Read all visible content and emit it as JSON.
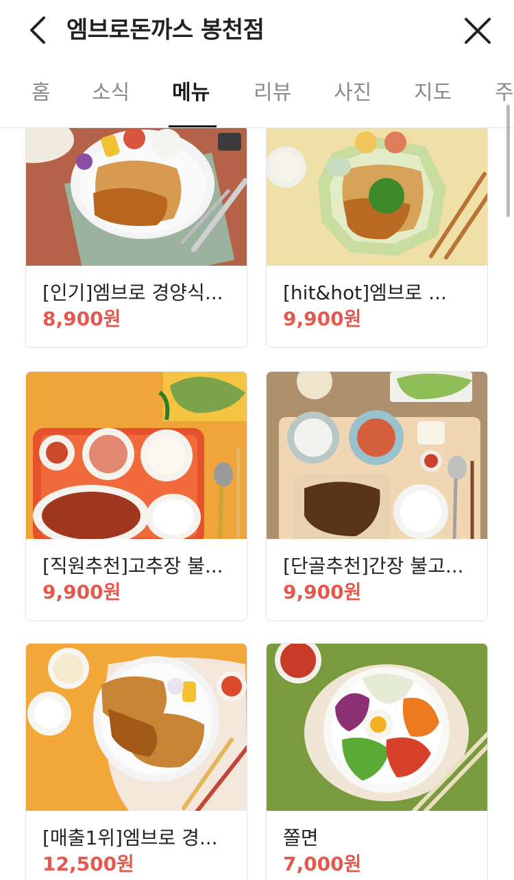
{
  "header": {
    "title": "엠브로돈까스 봉천점",
    "back_icon": "chevron-left-icon",
    "close_icon": "close-icon"
  },
  "tabs": [
    {
      "label": "홈",
      "active": false
    },
    {
      "label": "소식",
      "active": false
    },
    {
      "label": "메뉴",
      "active": true
    },
    {
      "label": "리뷰",
      "active": false
    },
    {
      "label": "사진",
      "active": false
    },
    {
      "label": "지도",
      "active": false
    },
    {
      "label": "주",
      "active": false
    }
  ],
  "colors": {
    "price": "#e25a4f",
    "active_tab": "#1a1a1a",
    "inactive_tab": "#8a8a8a"
  },
  "menu": [
    {
      "name": "[인기]엠브로 경양식...",
      "price": "8,900원",
      "image": "pork-cutlet-salad-photo"
    },
    {
      "name": "[hit&hot]엠브로 ...",
      "price": "9,900원",
      "image": "pork-cutlet-green-onion-photo"
    },
    {
      "name": "[직원추천]고추장 불...",
      "price": "9,900원",
      "image": "spicy-pork-bulgogi-photo"
    },
    {
      "name": "[단골추천]간장 불고...",
      "price": "9,900원",
      "image": "soy-pork-bulgogi-photo"
    },
    {
      "name": "[매출1위]엠브로 경...",
      "price": "12,500원",
      "image": "double-pork-cutlet-photo"
    },
    {
      "name": "쫄면",
      "price": "7,000원",
      "image": "jjolmyeon-noodles-photo"
    }
  ]
}
